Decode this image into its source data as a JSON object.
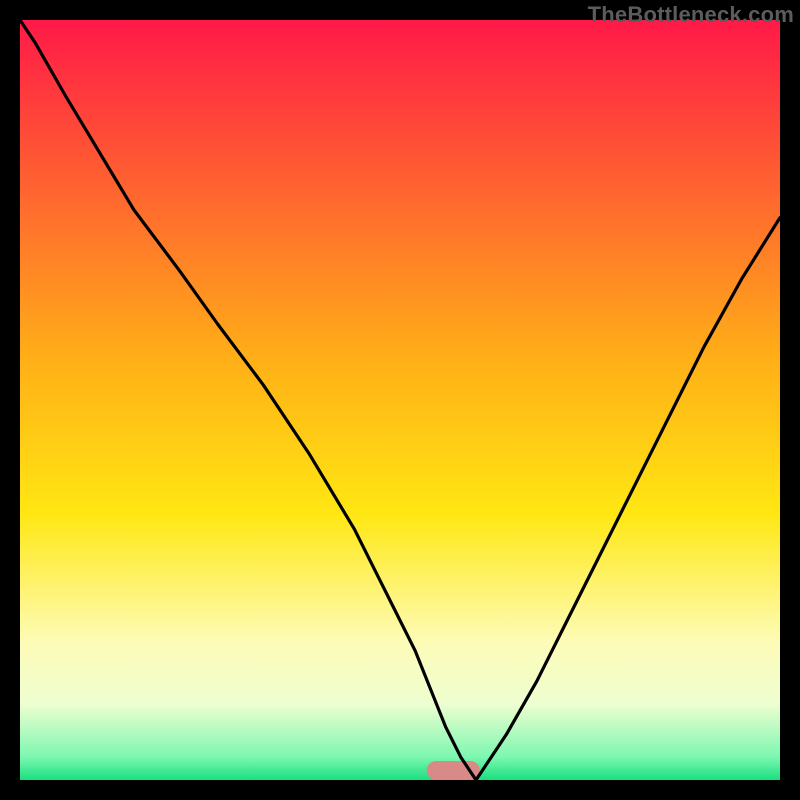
{
  "watermark": "TheBottleneck.com",
  "chart_data": {
    "type": "line",
    "title": "",
    "xlabel": "",
    "ylabel": "",
    "xlim": [
      0,
      100
    ],
    "ylim": [
      0,
      100
    ],
    "grid": false,
    "legend": false,
    "background_gradient": {
      "stops": [
        {
          "offset": 0.0,
          "color": "#ff1948"
        },
        {
          "offset": 0.45,
          "color": "#ffb017"
        },
        {
          "offset": 0.65,
          "color": "#ffe713"
        },
        {
          "offset": 0.82,
          "color": "#fdfcb8"
        },
        {
          "offset": 0.9,
          "color": "#eefed0"
        },
        {
          "offset": 0.97,
          "color": "#7cf7b0"
        },
        {
          "offset": 1.0,
          "color": "#18e07f"
        }
      ]
    },
    "series": [
      {
        "name": "bottleneck-curve",
        "color": "#000000",
        "x": [
          0,
          2,
          6,
          12,
          15,
          21,
          26,
          32,
          38,
          44,
          48,
          52,
          54,
          56,
          58,
          60,
          64,
          68,
          72,
          76,
          80,
          85,
          90,
          95,
          100
        ],
        "values": [
          100,
          97,
          90,
          80,
          75,
          67,
          60,
          52,
          43,
          33,
          25,
          17,
          12,
          7,
          3,
          0,
          6,
          13,
          21,
          29,
          37,
          47,
          57,
          66,
          74
        ]
      }
    ],
    "marker": {
      "name": "optimal-zone",
      "x_center": 57,
      "y": 0,
      "width": 7,
      "height": 2.5,
      "color": "#d98a87"
    }
  }
}
